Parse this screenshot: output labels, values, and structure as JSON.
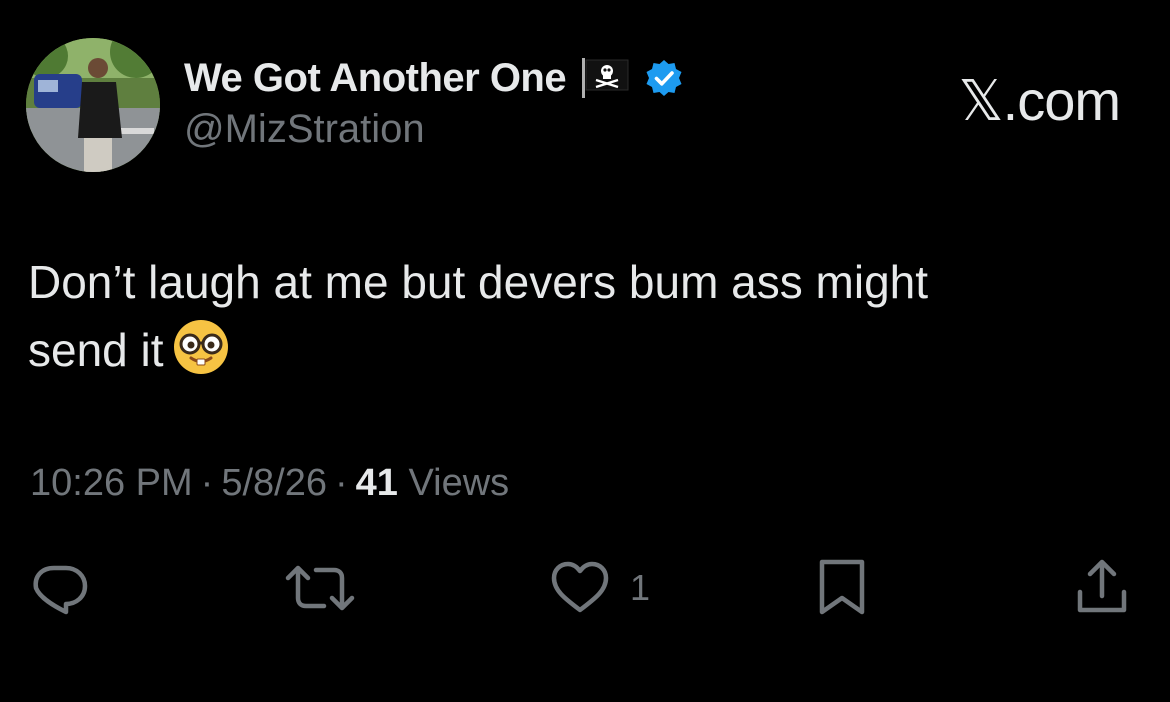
{
  "author": {
    "display_name": "We Got Another One",
    "handle": "@MizStration",
    "flag_icon": "pirate-flag-icon",
    "verified_icon": "verified-badge-icon",
    "verified_color": "#1d9bf0"
  },
  "brand": {
    "logo_text": "𝕏.com"
  },
  "tweet": {
    "text_line1": "Don’t laugh at me but devers bum ass might",
    "text_line2": "send it",
    "emoji_icon": "nerd-face-emoji"
  },
  "meta": {
    "time": "10:26 PM",
    "separator": "·",
    "date": "5/8/26",
    "views_count": "41",
    "views_label": "Views"
  },
  "actions": {
    "reply_icon": "reply-icon",
    "retweet_icon": "retweet-icon",
    "like_icon": "heart-icon",
    "like_count": "1",
    "bookmark_icon": "bookmark-icon",
    "share_icon": "share-icon"
  },
  "colors": {
    "background": "#000000",
    "primary_text": "#e7e9ea",
    "secondary_text": "#71767b",
    "accent": "#1d9bf0"
  }
}
